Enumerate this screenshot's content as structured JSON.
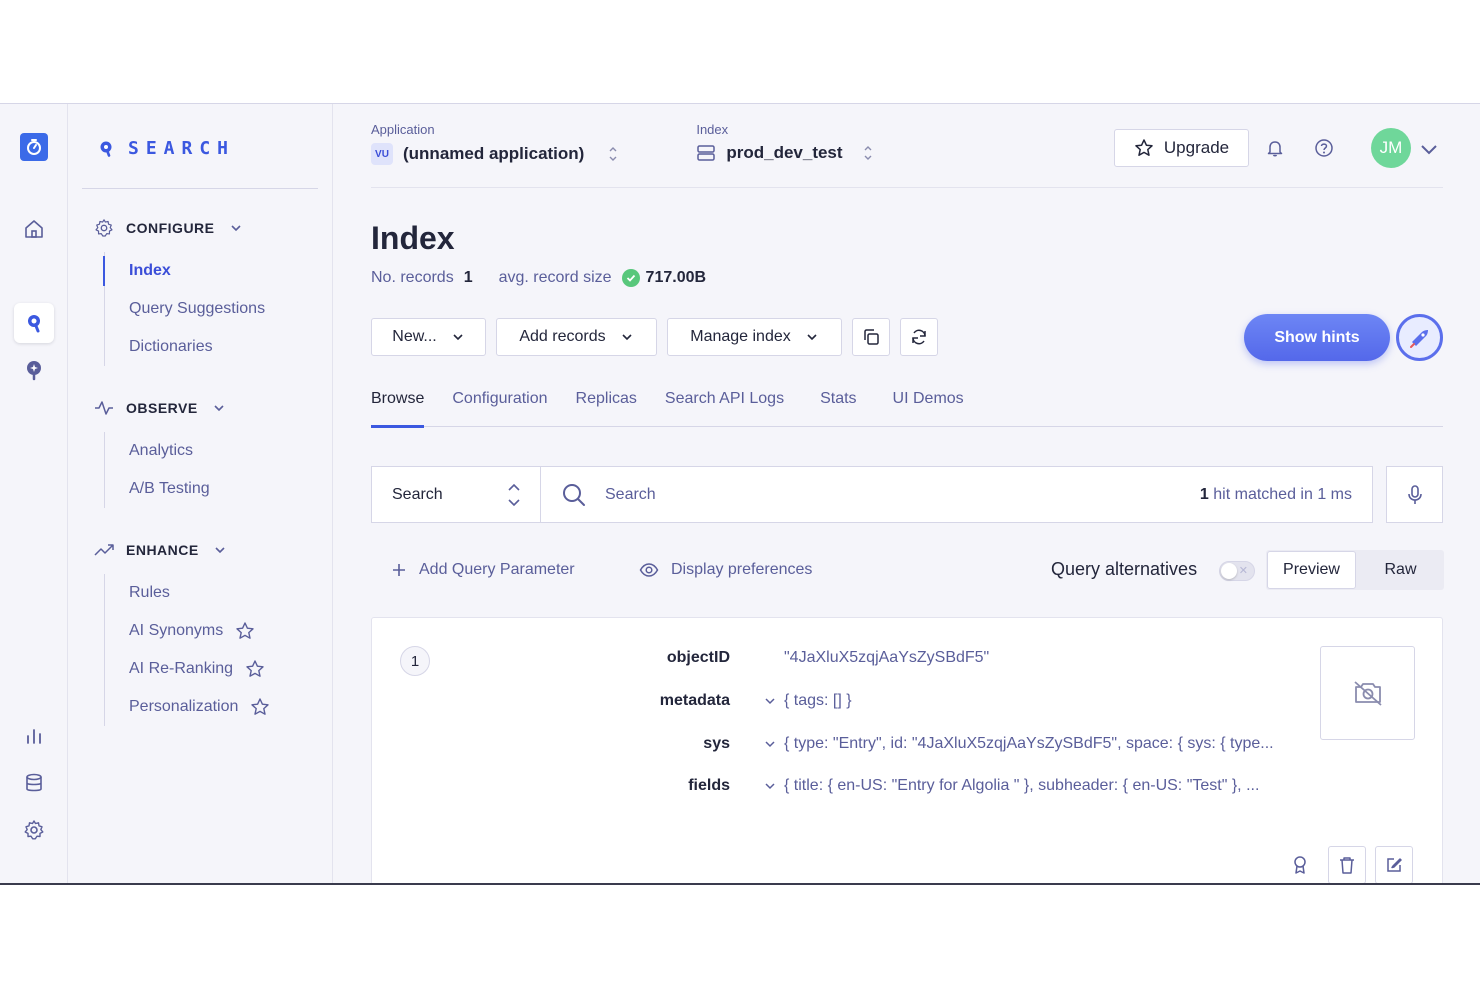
{
  "brand": {
    "name": "SEARCH"
  },
  "sidebar": {
    "groups": [
      {
        "label": "CONFIGURE",
        "items": [
          {
            "label": "Index",
            "active": true
          },
          {
            "label": "Query Suggestions"
          },
          {
            "label": "Dictionaries"
          }
        ]
      },
      {
        "label": "OBSERVE",
        "items": [
          {
            "label": "Analytics"
          },
          {
            "label": "A/B Testing"
          }
        ]
      },
      {
        "label": "ENHANCE",
        "items": [
          {
            "label": "Rules"
          },
          {
            "label": "AI Synonyms",
            "star": true
          },
          {
            "label": "AI Re-Ranking",
            "star": true
          },
          {
            "label": "Personalization",
            "star": true
          }
        ]
      }
    ]
  },
  "header": {
    "application_label": "Application",
    "application_badge": "VU",
    "application_name": "(unnamed application)",
    "index_label": "Index",
    "index_name": "prod_dev_test",
    "upgrade_label": "Upgrade",
    "avatar_initials": "JM"
  },
  "page": {
    "title": "Index",
    "records_label": "No. records",
    "records_value": "1",
    "size_label": "avg. record size",
    "size_value": "717.00B"
  },
  "toolbar": {
    "new_label": "New...",
    "add_records_label": "Add records",
    "manage_index_label": "Manage index",
    "show_hints_label": "Show hints"
  },
  "tabs": [
    "Browse",
    "Configuration",
    "Replicas",
    "Search API Logs",
    "Stats",
    "UI Demos"
  ],
  "search": {
    "type_label": "Search",
    "placeholder": "Search",
    "hits_count": "1",
    "hits_text": "hit matched in 1 ms"
  },
  "params": {
    "add_query_label": "Add Query Parameter",
    "display_prefs_label": "Display preferences",
    "query_alternatives_label": "Query alternatives",
    "preview_label": "Preview",
    "raw_label": "Raw"
  },
  "record": {
    "number": "1",
    "attributes": [
      {
        "key": "objectID",
        "value": "\"4JaXluX5zqjAaYsZySBdF5\"",
        "expandable": false
      },
      {
        "key": "metadata",
        "value": "{ tags: [] }",
        "expandable": true
      },
      {
        "key": "sys",
        "value": "{ type: \"Entry\", id: \"4JaXluX5zqjAaYsZySBdF5\", space: { sys: { type...",
        "expandable": true
      },
      {
        "key": "fields",
        "value": "{ title: { en-US: \"Entry for Algolia \" }, subheader: { en-US: \"Test\" }, ...",
        "expandable": true
      }
    ]
  },
  "colors": {
    "accent": "#3b58e0",
    "success": "#58c77b",
    "avatar": "#6fd79a"
  }
}
